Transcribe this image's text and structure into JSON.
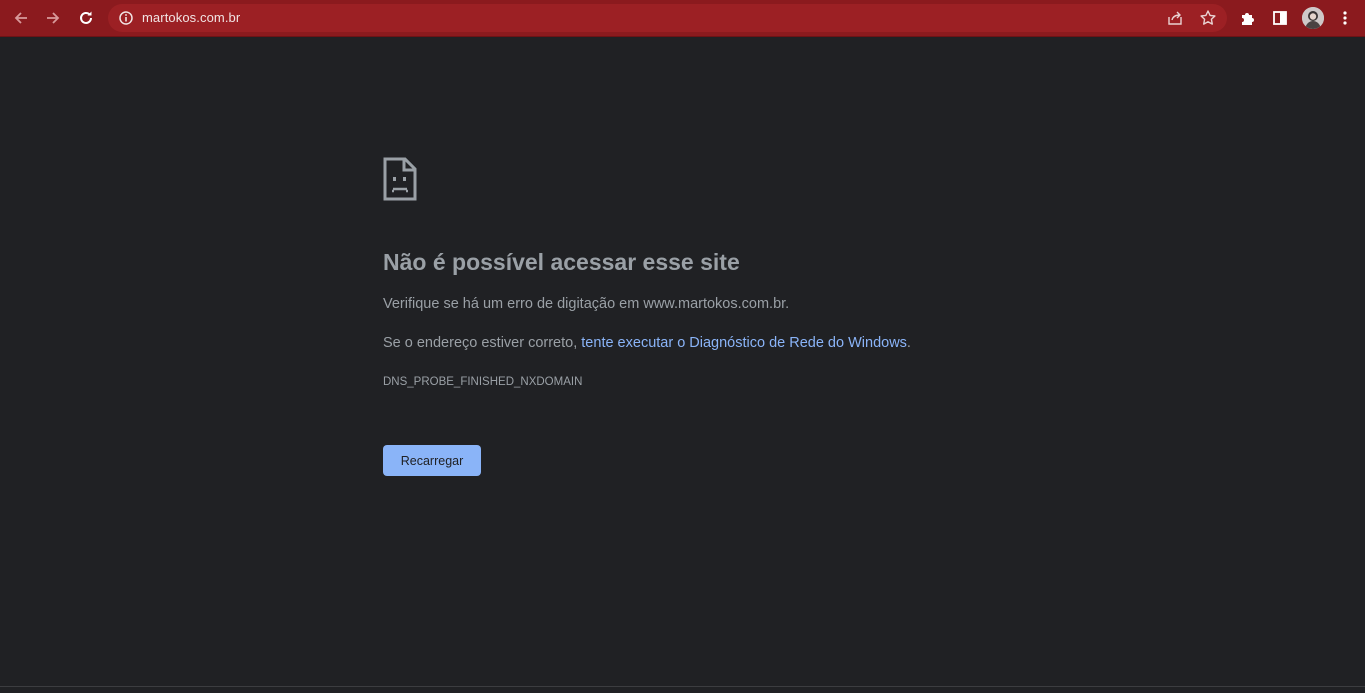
{
  "browser": {
    "url": "martokos.com.br",
    "icons": {
      "back": "arrow-left-icon",
      "forward": "arrow-right-icon",
      "reload": "reload-icon",
      "info": "info-icon",
      "share": "share-icon",
      "bookmark": "star-icon",
      "extensions": "puzzle-icon",
      "side_panel": "side-panel-icon",
      "menu": "kebab-menu-icon"
    },
    "colors": {
      "frame": "#8b1a1e",
      "omnibox": "#9c2024"
    }
  },
  "error_page": {
    "icon": "sad-document-icon",
    "heading": "Não é possível acessar esse site",
    "line1": "Verifique se há um erro de digitação em www.martokos.com.br.",
    "line2_prefix": "Se o endereço estiver correto, ",
    "line2_link": "tente executar o Diagnóstico de Rede do Windows",
    "line2_suffix": ".",
    "error_code": "DNS_PROBE_FINISHED_NXDOMAIN",
    "reload_button": "Recarregar",
    "colors": {
      "background": "#202124",
      "text": "#9aa0a6",
      "link": "#8ab4f8",
      "button": "#8ab4f8"
    }
  }
}
